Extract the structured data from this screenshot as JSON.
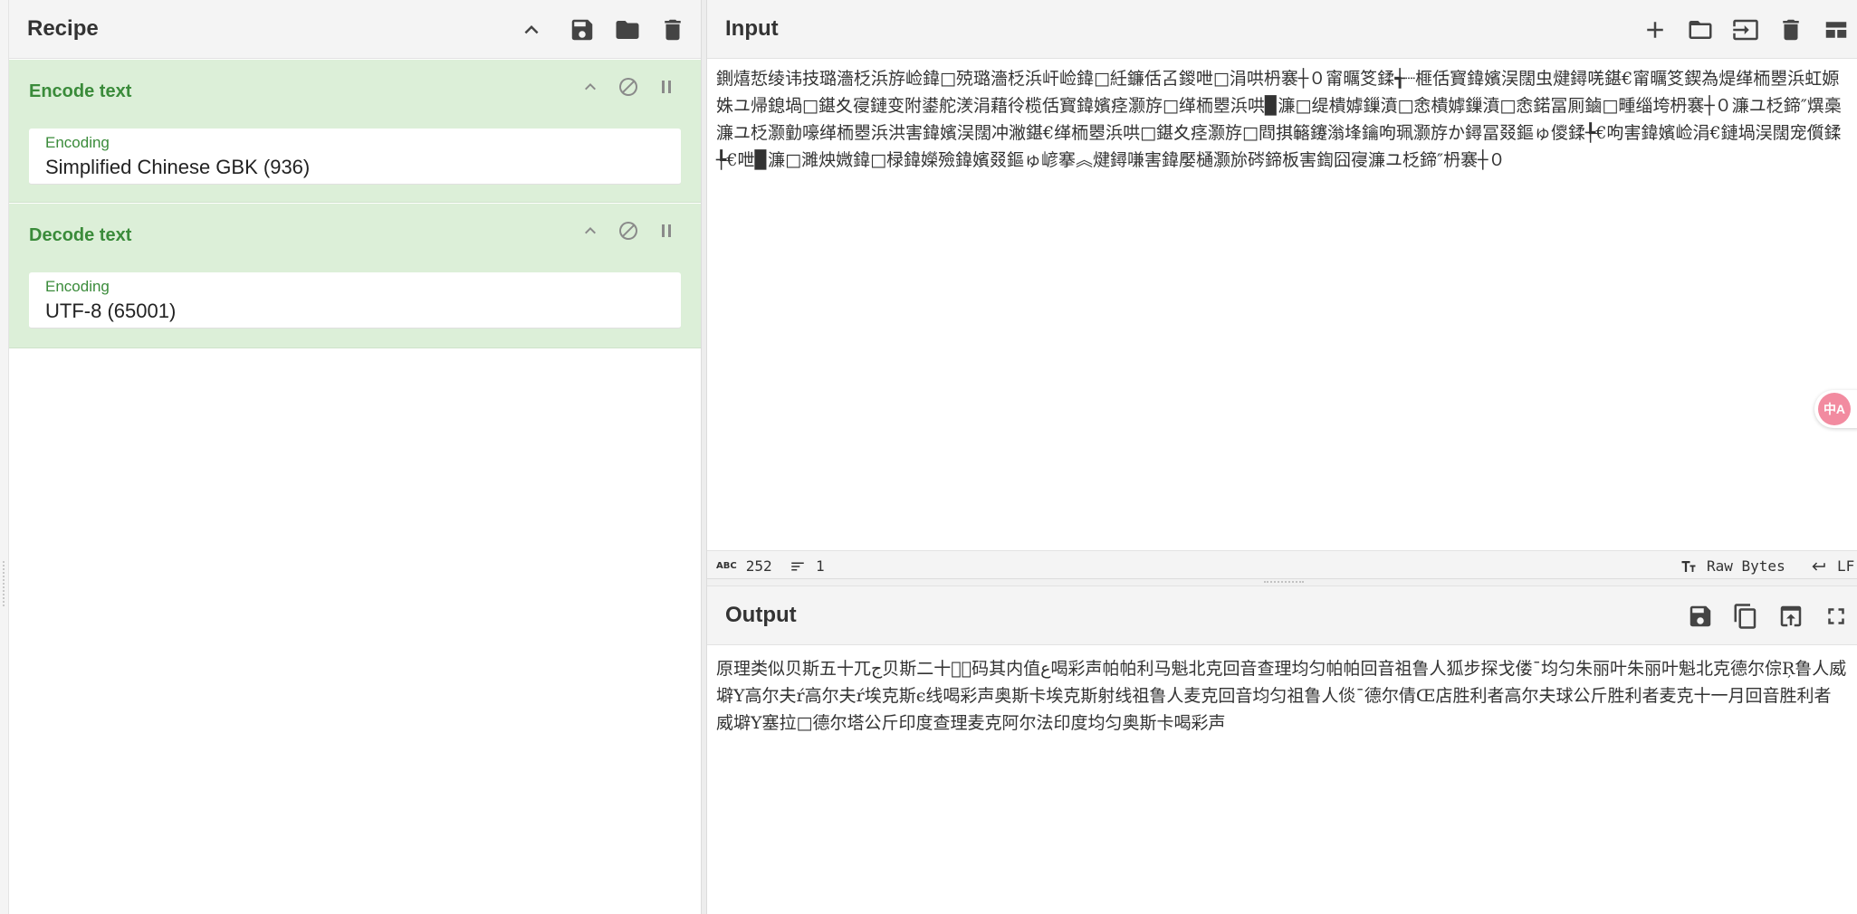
{
  "recipe": {
    "title": "Recipe",
    "operations": [
      {
        "name": "Encode text",
        "field_label": "Encoding",
        "field_value": "Simplified Chinese GBK (936)"
      },
      {
        "name": "Decode text",
        "field_label": "Encoding",
        "field_value": "UTF-8 (65001)"
      }
    ]
  },
  "input": {
    "title": "Input",
    "text": "鍘熺悊绫讳技璐濇柉浜斿崄鍏□殑璐濇柉浜屽崄鍏□紝鐮佸叾鍐呭□涓哄枬褰┼０甯曞笅鍒╅┈榧佸寳鍏嬪洖闊虫煡鐞唴鍖€甯曞笅鍥為煶缂栭瞾浜虹嫄姝ユ帰鎴堝□鍖夊寑鏈变附鍙舵湵涓藉彾榄佸寳鍏嬪痉灏斿□缂栭瞾浜哄▉濂□缇樻嫭鏁濆□悆樻嫭鏁濆□悆鍩冨厠鏀□畽缁垮枬褰┼０濂ユ柉鍗″熼槀濂ユ柉灏勭嚎缂栭瞾浜洪害鍏嬪洖闊冲潎鍖€缂栭瞾浜哄□鍖夊痉灏斿□閰掑簵鑳滃埄鑰呴珮灏斿か鐞冨叕鏂ゅ儍鍒╄€呴害鍏嬪崄涓€鏈堝洖闊宠儨鍒╄€呭▉濂□濉炴媺鍏□椂鍏嬫殮鍏嬪叕鏂ゅ嵃搴︽煡鐞嗛害鍏嬮樋灏旀硶鍗板害鍧囧寑濂ユ柉鍗″枬褰┼０",
    "char_count": "252",
    "line_count": "1",
    "encoding_label": "Raw Bytes",
    "eol_label": "LF"
  },
  "output": {
    "title": "Output",
    "text": "原理类似贝斯五十兀ج贝斯二十兀ٍ码其内值ع喝彩声帕帕利马魁北克回音查理均匀帕帕回音祖鲁人狐步探戈偻ˉ均匀朱丽叶朱丽叶魁北克德尔倧Ŗ鲁人威壀Y高尔夫ŕ高尔夫ŕ埃克斯ϵ线喝彩声奥斯卡埃克斯射线祖鲁人麦克回音均匀祖鲁人倓ˉ德尔倩Œ店胜利者高尔夫球公斤胜利者麦克十一月回音胜利者威壀Y塞拉□德尔塔公斤印度查理麦克阿尔法印度均匀奥斯卡喝彩声"
  },
  "translate_fab": "中A",
  "colors": {
    "op_bg": "#dcefd8",
    "op_title": "#3a8b3a",
    "header_bg": "#f4f4f4"
  }
}
